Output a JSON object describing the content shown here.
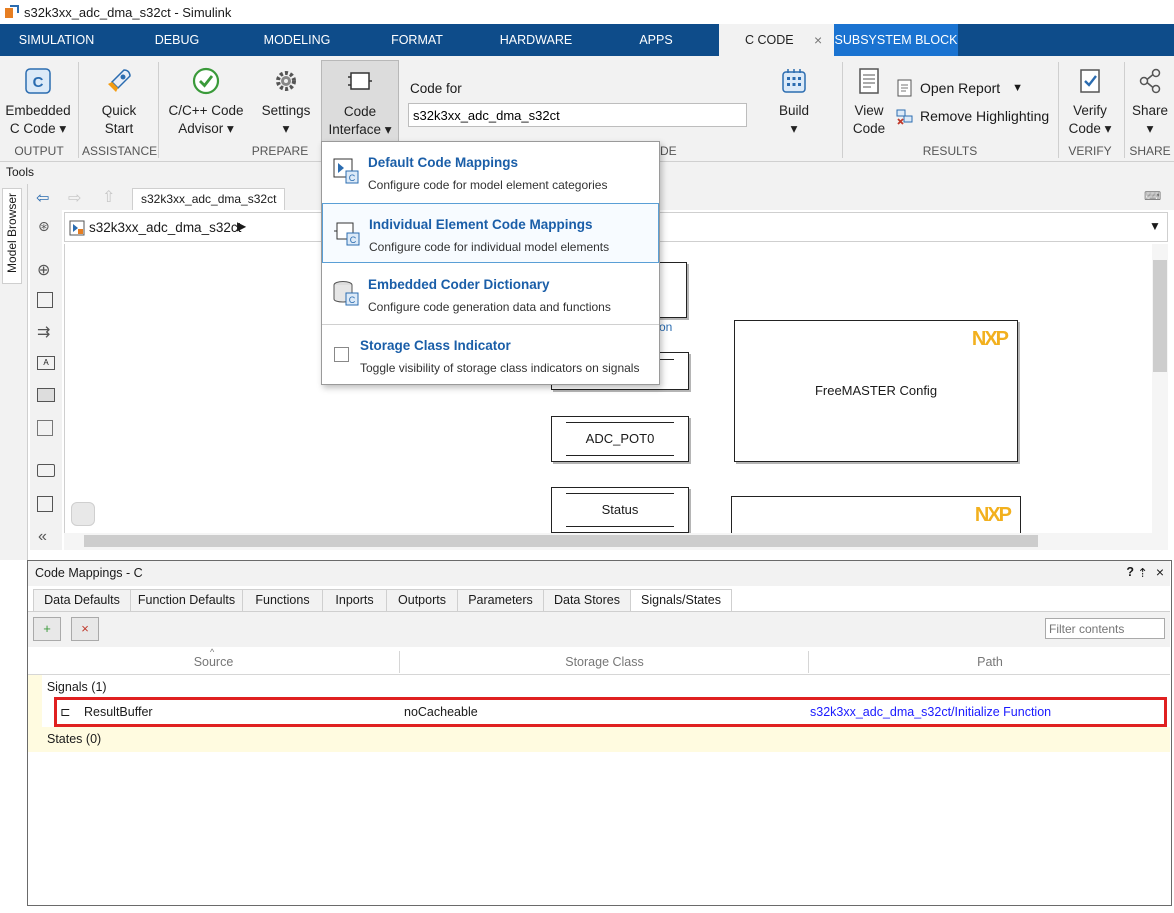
{
  "window": {
    "title": "s32k3xx_adc_dma_s32ct - Simulink"
  },
  "ribbon_tabs": [
    "SIMULATION",
    "DEBUG",
    "MODELING",
    "FORMAT",
    "HARDWARE",
    "APPS",
    "C CODE",
    "SUBSYSTEM BLOCK"
  ],
  "ribbon_tab_close": "×",
  "ribbon": {
    "embedded_c_code": [
      "Embedded",
      "C Code ▾"
    ],
    "quick_start": [
      "Quick",
      "Start"
    ],
    "code_advisor": [
      "C/C++ Code",
      "Advisor ▾"
    ],
    "settings": [
      "Settings",
      "▾"
    ],
    "code_interface": [
      "Code",
      "Interface ▾"
    ],
    "code_for_label": "Code for",
    "code_for_value": "s32k3xx_adc_dma_s32ct",
    "build": [
      "Build",
      "▾"
    ],
    "view_code": [
      "View",
      "Code"
    ],
    "open_report": "Open Report",
    "remove_highlighting": "Remove Highlighting",
    "verify_code": [
      "Verify",
      "Code ▾"
    ],
    "share": [
      "Share",
      "▾"
    ],
    "groups": {
      "output": "OUTPUT",
      "assistance": "ASSISTANCE",
      "prepare": "PREPARE",
      "code_partial": "DE",
      "results": "RESULTS",
      "verify": "VERIFY",
      "share": "SHARE"
    }
  },
  "tools_label": "Tools",
  "model_browser": "Model Browser",
  "breadcrumb_tab": "s32k3xx_adc_dma_s32ct",
  "address": "s32k3xx_adc_dma_s32ct",
  "dropdown": [
    {
      "title": "Default Code Mappings",
      "desc": "Configure code for model element categories"
    },
    {
      "title": "Individual Element Code Mappings",
      "desc": "Configure code for individual model elements"
    },
    {
      "title": "Embedded Coder Dictionary",
      "desc": "Configure code generation data and functions"
    },
    {
      "title": "Storage Class Indicator",
      "desc": "Toggle visibility of storage class indicators on signals"
    }
  ],
  "canvas": {
    "block_adc": "ADC_POT0",
    "block_status": "Status",
    "block_freemaster": "FreeMASTER Config",
    "partial_label": "on",
    "nxp_logo": "NXP"
  },
  "panel": {
    "title": "Code Mappings - C",
    "tabs": [
      "Data Defaults",
      "Function Defaults",
      "Functions",
      "Inports",
      "Outports",
      "Parameters",
      "Data Stores",
      "Signals/States"
    ],
    "filter_placeholder": "Filter contents",
    "columns": [
      "Source",
      "Storage Class",
      "Path"
    ],
    "signals_group": "Signals (1)",
    "signal_row": {
      "source": "ResultBuffer",
      "storage_class": "noCacheable",
      "path": "s32k3xx_adc_dma_s32ct/Initialize Function"
    },
    "states_group": "States (0)"
  },
  "colors": {
    "tabstrip": "#0e4c8a",
    "subsystem_tab": "#1a73d1",
    "link": "#1a1aff",
    "highlight": "#e02020"
  }
}
